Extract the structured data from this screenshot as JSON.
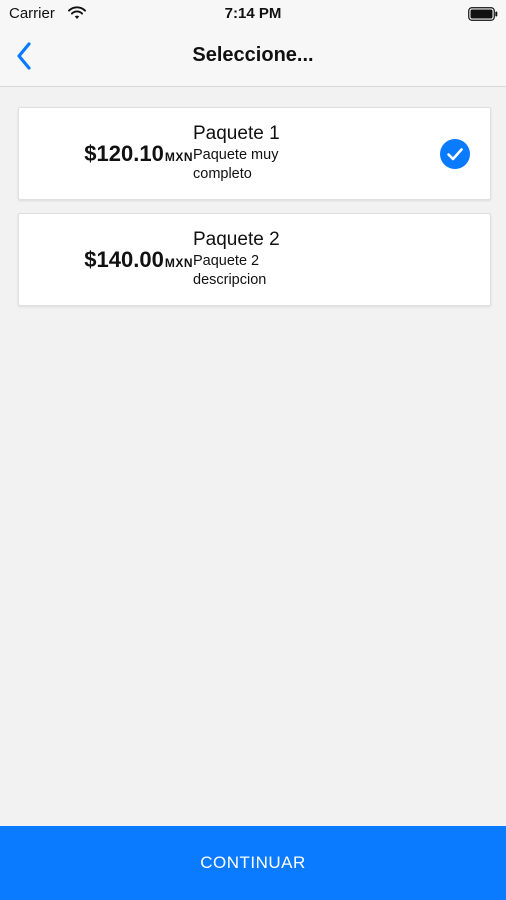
{
  "status_bar": {
    "carrier": "Carrier",
    "time": "7:14 PM",
    "icons": [
      "wifi-icon",
      "battery-icon"
    ]
  },
  "nav": {
    "title": "Seleccione...",
    "back_icon": "chevron-left-icon"
  },
  "packages": [
    {
      "price": "$120.10",
      "currency": "MXN",
      "name": "Paquete 1",
      "description": "Paquete muy completo",
      "selected": true
    },
    {
      "price": "$140.00",
      "currency": "MXN",
      "name": "Paquete 2",
      "description": "Paquete 2 descripcion",
      "selected": false
    }
  ],
  "footer": {
    "continue_label": "CONTINUAR"
  },
  "colors": {
    "accent": "#0a7aff",
    "background": "#f2f2f2",
    "card": "#ffffff",
    "bar": "#f7f7f7"
  }
}
